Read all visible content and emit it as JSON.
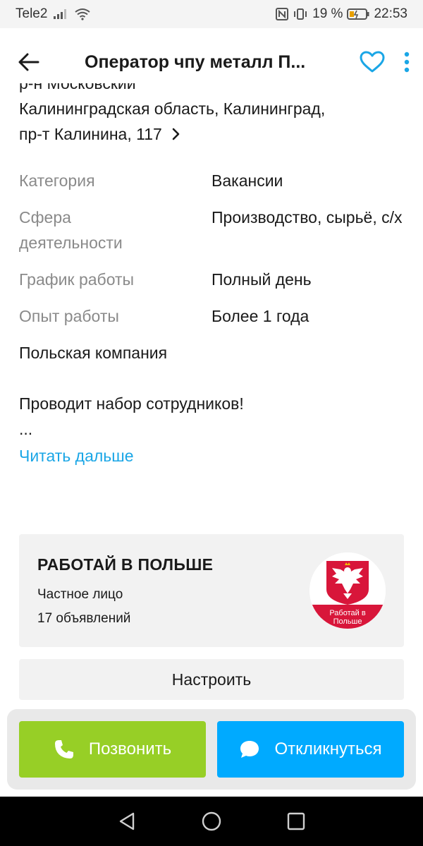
{
  "status_bar": {
    "carrier": "Tele2",
    "battery_percent": "19 %",
    "time": "22:53"
  },
  "header": {
    "title": "Оператор чпу металл П...",
    "accent_color": "#1aa6e6"
  },
  "address": {
    "district": "р-н Московский",
    "line1": "Калининградская область, Калининград,",
    "line2": "пр-т Калинина, 117"
  },
  "properties": [
    {
      "label": "Категория",
      "value": "Вакансии"
    },
    {
      "label": "Сфера деятельности",
      "value": "Производство, сырьё, с/х"
    },
    {
      "label": "График работы",
      "value": "Полный день"
    },
    {
      "label": "Опыт работы",
      "value": "Более 1 года"
    }
  ],
  "description": {
    "line1": "Польская компания",
    "line2": "Проводит набор сотрудников!",
    "line3": "...",
    "read_more": "Читать дальше"
  },
  "seller": {
    "name": "РАБОТАЙ В ПОЛЬШЕ",
    "type": "Частное лицо",
    "listings": "17 объявлений",
    "avatar_text_line1": "Работай в",
    "avatar_text_line2": "Польше"
  },
  "setup_button": "Настроить",
  "actions": {
    "call": "Позвонить",
    "reply": "Откликнуться",
    "call_color": "#97cf26",
    "reply_color": "#00aaff"
  }
}
